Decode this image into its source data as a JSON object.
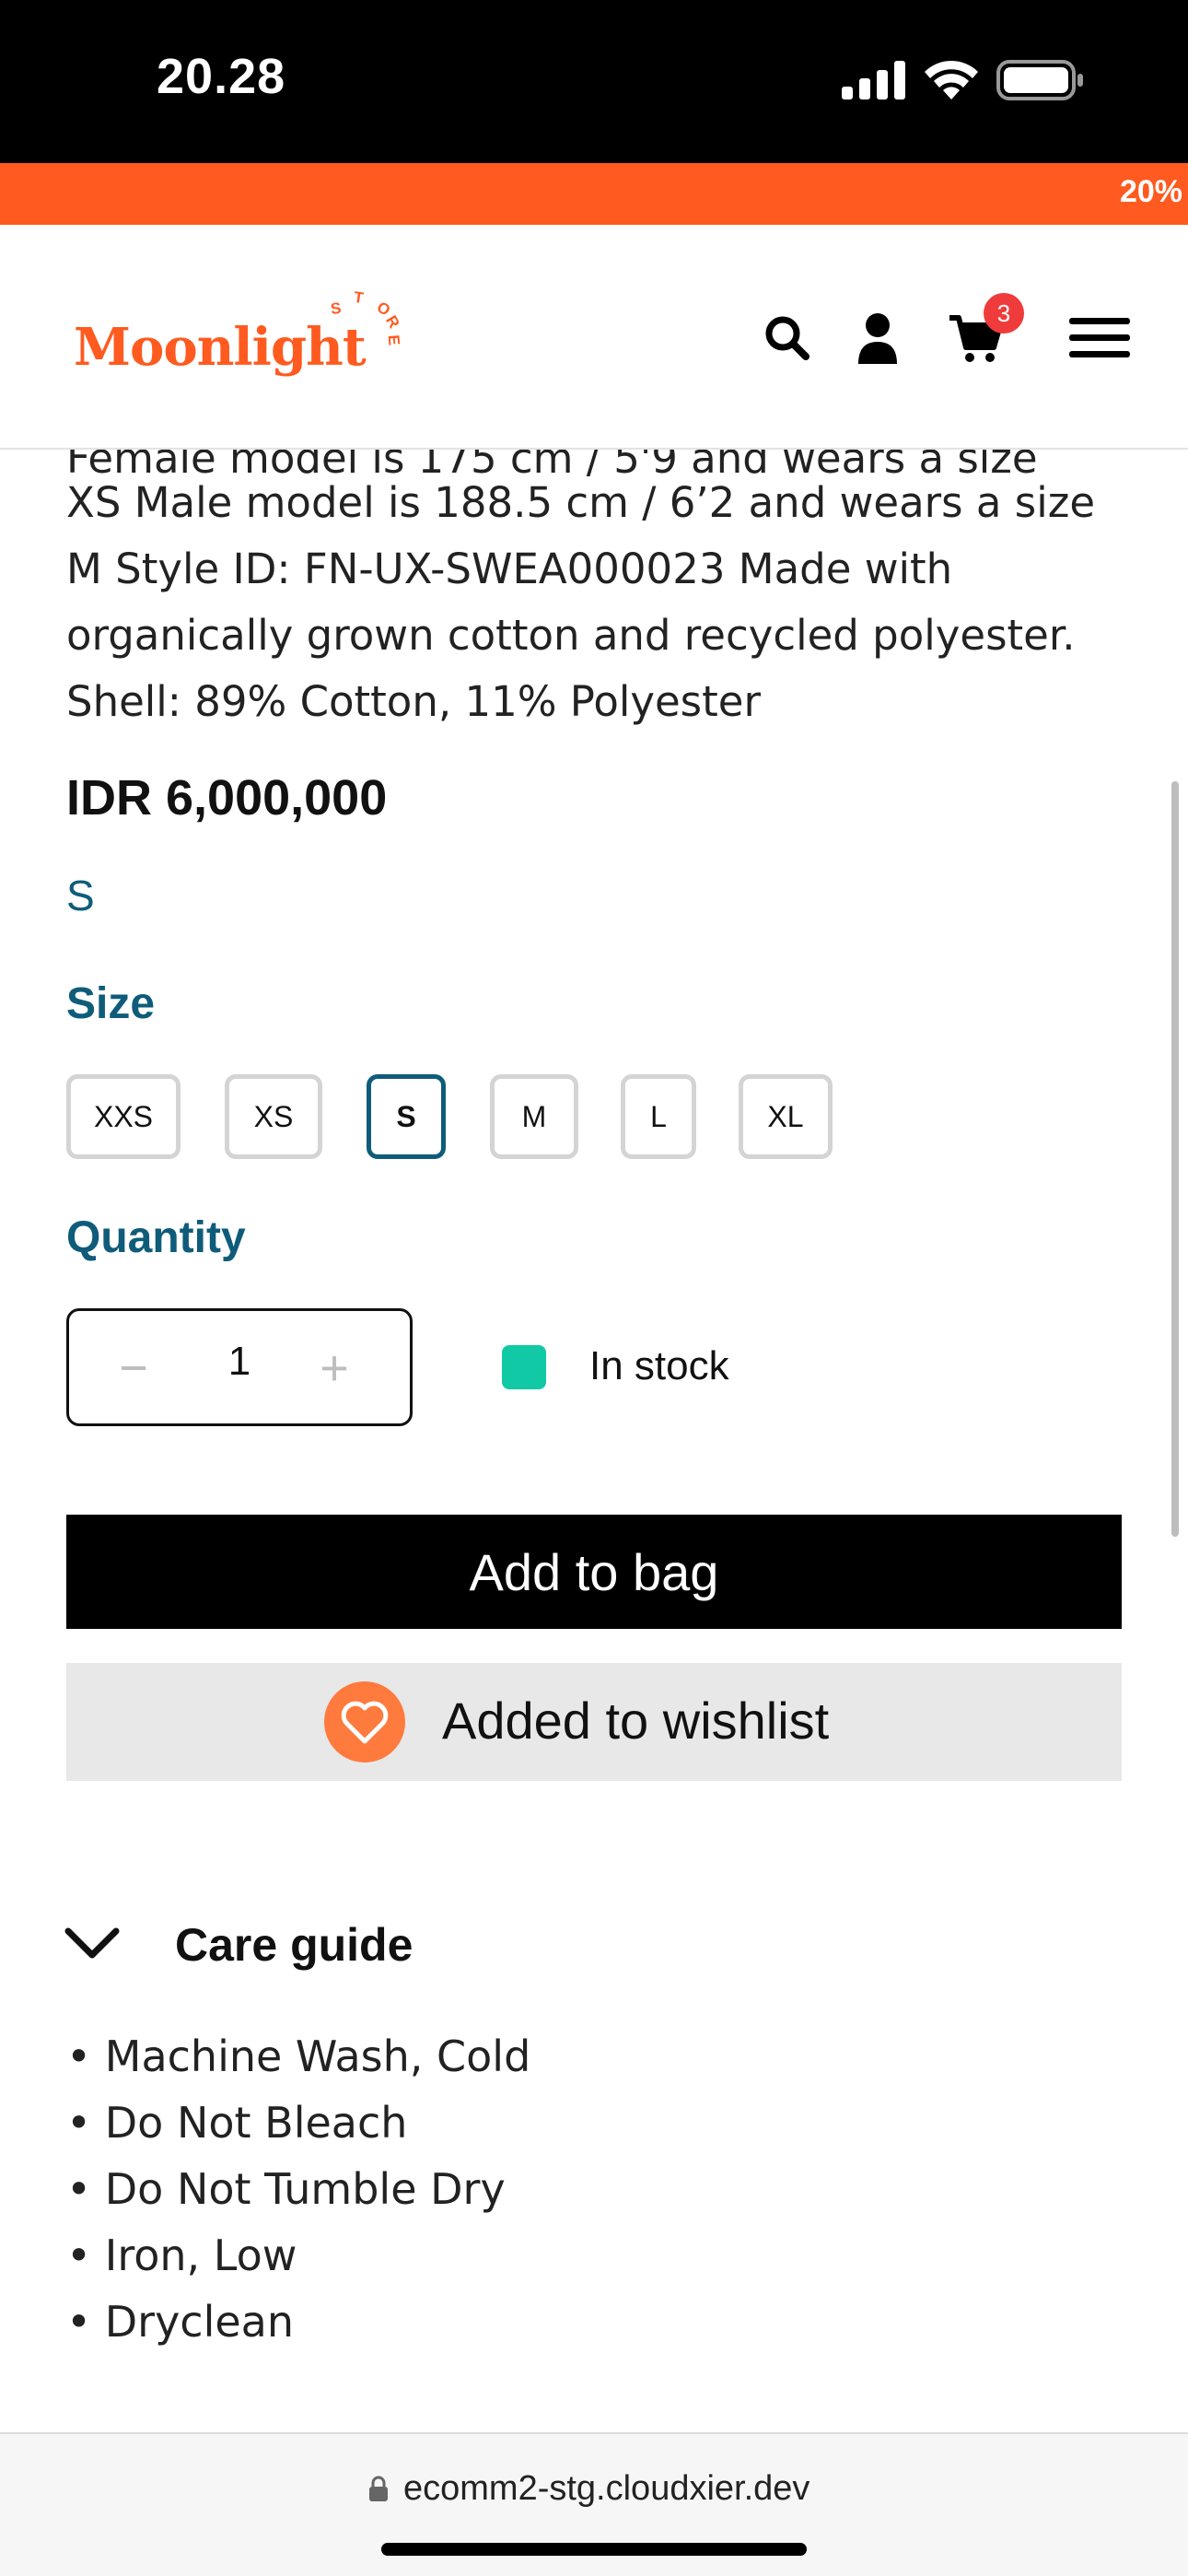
{
  "status_bar": {
    "time": "20.28"
  },
  "promo": {
    "text": "20%"
  },
  "header": {
    "logo_text": "Moonlight",
    "logo_sub": "STORE",
    "cart_count": "3"
  },
  "product": {
    "description_cut": "Female model is 175 cm / 5'9 and wears a size",
    "description": "XS Male model is 188.5 cm / 6’2 and wears a size M Style ID: FN-UX-SWEA000023 Made with organically grown cotton and recycled polyester. Shell: 89% Cotton, 11% Polyester",
    "price": "IDR 6,000,000",
    "selected_size": "S",
    "size_heading": "Size",
    "sizes": [
      "XXS",
      "XS",
      "S",
      "M",
      "L",
      "XL"
    ],
    "quantity_heading": "Quantity",
    "quantity": "1",
    "quantity_minus": "−",
    "quantity_plus": "+",
    "stock_status": "In stock",
    "stock_color": "#12c9a6",
    "add_to_bag": "Add to bag",
    "wishlist_label": "Added to wishlist"
  },
  "care": {
    "heading": "Care guide",
    "items": [
      "• Machine Wash, Cold",
      "• Do Not Bleach",
      "• Do Not Tumble Dry",
      "• Iron, Low",
      "• Dryclean"
    ]
  },
  "browser": {
    "url": "ecomm2-stg.cloudxier.dev"
  },
  "colors": {
    "brand": "#ff5a1f",
    "accent": "#0f5c7a",
    "wishlist_heart": "#ff7a3d"
  }
}
